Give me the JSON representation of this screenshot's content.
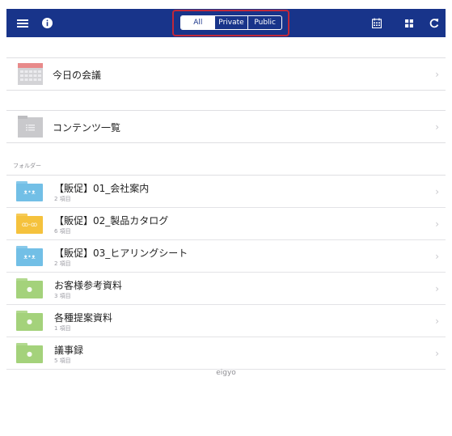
{
  "topbar": {
    "segments": [
      "All",
      "Private",
      "Public"
    ],
    "active_segment": "All"
  },
  "pinned": [
    {
      "title": "今日の会議",
      "icon": "calendar-icon"
    },
    {
      "title": "コンテンツ一覧",
      "icon": "list-tray-icon"
    }
  ],
  "section_label": "フォルダー",
  "folders": [
    {
      "title": "【販促】01_会社案内",
      "count": "2 項目",
      "color": "#72bfe6",
      "icon": "group-icon"
    },
    {
      "title": "【販促】02_製品カタログ",
      "count": "6 項目",
      "color": "#f5c23d",
      "icon": "people-icon"
    },
    {
      "title": "【販促】03_ヒアリングシート",
      "count": "2 項目",
      "color": "#72bfe6",
      "icon": "group-icon"
    },
    {
      "title": "お客様参考資料",
      "count": "3 項目",
      "color": "#a4d27b",
      "icon": "person-icon"
    },
    {
      "title": "各種提案資料",
      "count": "1 項目",
      "color": "#a4d27b",
      "icon": "person-icon"
    },
    {
      "title": "議事録",
      "count": "5 項目",
      "color": "#a4d27b",
      "icon": "person-icon"
    }
  ],
  "footer": "eigyo",
  "colors": {
    "topbar": "#18348a",
    "highlight": "#c0283a"
  }
}
